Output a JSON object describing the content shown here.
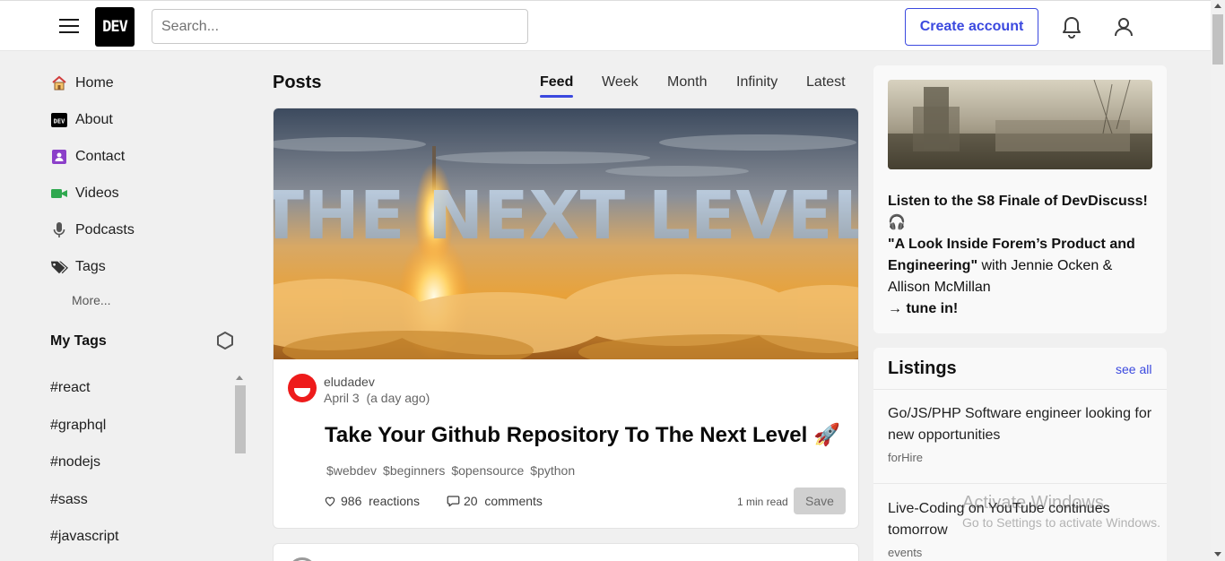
{
  "header": {
    "logo_text": "DEV",
    "search_placeholder": "Search...",
    "create_account": "Create account"
  },
  "sidebar": {
    "items": [
      {
        "label": "Home",
        "icon": "house-icon"
      },
      {
        "label": "About",
        "icon": "dev-logo-icon"
      },
      {
        "label": "Contact",
        "icon": "contact-icon"
      },
      {
        "label": "Videos",
        "icon": "video-camera-icon"
      },
      {
        "label": "Podcasts",
        "icon": "microphone-icon"
      },
      {
        "label": "Tags",
        "icon": "tags-icon"
      }
    ],
    "more": "More...",
    "my_tags_heading": "My Tags",
    "tags": [
      "#react",
      "#graphql",
      "#nodejs",
      "#sass",
      "#javascript"
    ]
  },
  "main": {
    "title": "Posts",
    "tabs": [
      {
        "label": "Feed",
        "active": true
      },
      {
        "label": "Week",
        "active": false
      },
      {
        "label": "Month",
        "active": false
      },
      {
        "label": "Infinity",
        "active": false
      },
      {
        "label": "Latest",
        "active": false
      }
    ],
    "post": {
      "cover_text": "THE NEXT LEVEL",
      "author": "eludadev",
      "date": "April 3",
      "relative_date": "(a day ago)",
      "title": "Take Your Github Repository To The Next Level 🚀",
      "tags": [
        "$webdev",
        "$beginners",
        "$opensource",
        "$python"
      ],
      "reactions_count": "986",
      "reactions_label": "reactions",
      "comments_count": "20",
      "comments_label": "comments",
      "read_time": "1 min read",
      "save_label": "Save"
    }
  },
  "right": {
    "promo": {
      "headline": "Listen to the S8 Finale of DevDiscuss!",
      "headphones": "🎧",
      "quote": "\"A Look Inside Forem’s Product and Engineering\"",
      "guests": " with Jennie Ocken & Allison McMillan",
      "cta": "→ tune in!"
    },
    "listings": {
      "heading": "Listings",
      "see_all": "see all",
      "items": [
        {
          "title": "Go/JS/PHP Software engineer looking for new opportunities",
          "category": "forHire"
        },
        {
          "title": "Live-Coding on YouTube continues tomorrow",
          "category": "events"
        }
      ]
    }
  },
  "watermark": {
    "line1": "Activate Windows",
    "line2": "Go to Settings to activate Windows."
  },
  "colors": {
    "accent": "#3b49df",
    "background": "#f0f0f0",
    "card": "#ffffff"
  }
}
